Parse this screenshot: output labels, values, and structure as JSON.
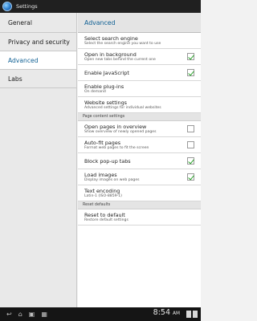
{
  "window": {
    "title": "Settings",
    "icon": "browser-globe-icon"
  },
  "sidebar": {
    "items": [
      {
        "label": "General"
      },
      {
        "label": "Privacy and security"
      },
      {
        "label": "Advanced"
      },
      {
        "label": "Labs"
      }
    ]
  },
  "panel": {
    "title": "Advanced",
    "rows": [
      {
        "title": "Select search engine",
        "subtitle": "Select the search engine you want to use"
      },
      {
        "title": "Open in background",
        "subtitle": "Open new tabs behind the current one",
        "checked": true
      },
      {
        "title": "Enable JavaScript",
        "checked": true
      },
      {
        "title": "Enable plug-ins",
        "subtitle": "On demand"
      },
      {
        "title": "Website settings",
        "subtitle": "Advanced settings for individual websites"
      }
    ],
    "section1": "Page content settings",
    "rows2": [
      {
        "title": "Open pages in overview",
        "subtitle": "Show overview of newly opened pages",
        "checked": false
      },
      {
        "title": "Auto-fit pages",
        "subtitle": "Format web pages to fit the screen",
        "checked": false
      },
      {
        "title": "Block pop-up tabs",
        "checked": true
      },
      {
        "title": "Load images",
        "subtitle": "Display images on web pages",
        "checked": true
      },
      {
        "title": "Text encoding",
        "subtitle": "Latin-1 (ISO-8859-1)"
      }
    ],
    "section2": "Reset defaults",
    "rows3": [
      {
        "title": "Reset to default",
        "subtitle": "Restore default settings"
      }
    ]
  },
  "system_bar": {
    "time": "8:54",
    "ampm": "AM"
  }
}
